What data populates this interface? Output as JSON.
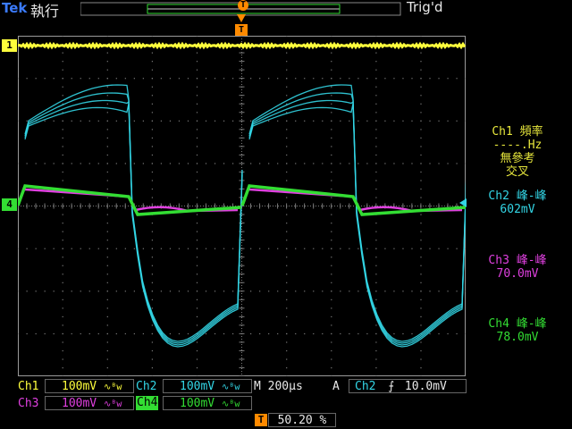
{
  "header": {
    "brand": "Tek",
    "state": "執行",
    "trigger_status": "Trig'd",
    "trigger_marker": "T"
  },
  "channels": {
    "ch1_marker": "1",
    "ch4_marker": "4"
  },
  "measurements": {
    "ch1_title": "Ch1 頻率",
    "ch1_value": "----.Hz",
    "ch1_note1": "無參考",
    "ch1_note2": "交叉",
    "ch2_title": "Ch2 峰-峰",
    "ch2_value": "602mV",
    "ch3_title": "Ch3 峰-峰",
    "ch3_value": "70.0mV",
    "ch4_title": "Ch4 峰-峰",
    "ch4_value": "78.0mV"
  },
  "footer": {
    "ch1_label": "Ch1",
    "ch1_scale": "100mV",
    "ch2_label": "Ch2",
    "ch2_scale": "100mV",
    "ch3_label": "Ch3",
    "ch3_scale": "100mV",
    "ch4_label": "Ch4",
    "ch4_scale": "100mV",
    "bw_symbol": "∿ᴮw",
    "timebase": "M 200µs",
    "acq_mode": "A",
    "trig_source": "Ch2",
    "trig_slope": "⨍",
    "trig_level": "10.0mV",
    "trig_pos_marker": "T",
    "trig_position": "50.20 %"
  },
  "colors": {
    "ch1": "#ffff3c",
    "ch2": "#33d6e6",
    "ch3": "#e040e0",
    "ch4": "#33dd33",
    "trigger": "#ff8a00",
    "grid": "#7a7a7a"
  }
}
